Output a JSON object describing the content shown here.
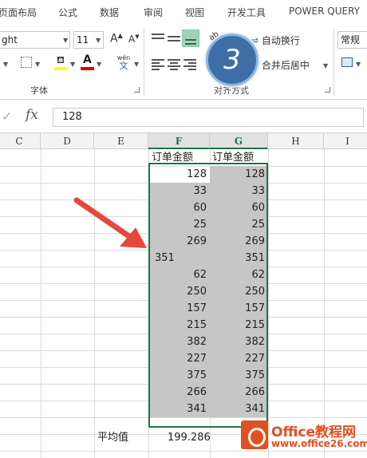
{
  "menu": {
    "tabs": [
      "页面布局",
      "公式",
      "数据",
      "审阅",
      "视图",
      "开发工具",
      "POWER QUERY"
    ]
  },
  "ribbon": {
    "font_name": "ght",
    "font_size": "11",
    "font_grow": "A",
    "font_shrink": "A",
    "font_color_letter": "A",
    "phonetic_top": "wén",
    "phonetic_bottom": "文",
    "font_group_label": "字体",
    "wrap_text": "自动换行",
    "merge_center": "合并后居中",
    "align_group_label": "对齐方式",
    "number_format": "常规",
    "orientation_label": "ab"
  },
  "formula_bar": {
    "fx_label": "fx",
    "value": "128"
  },
  "badge": {
    "label": "3"
  },
  "columns": [
    "C",
    "D",
    "E",
    "F",
    "G",
    "H",
    "I"
  ],
  "table": {
    "header_f": "订单金额",
    "header_g": "订单金额",
    "f_values": [
      "128",
      "33",
      "60",
      "25",
      "269",
      "351",
      "62",
      "250",
      "157",
      "215",
      "382",
      "227",
      "375",
      "266",
      "341"
    ],
    "g_values": [
      "128",
      "33",
      "60",
      "25",
      "269",
      "351",
      "62",
      "250",
      "157",
      "215",
      "382",
      "227",
      "375",
      "266",
      "341"
    ],
    "avg_label": "平均值",
    "avg_value": "199.286"
  },
  "watermark": {
    "title": "Office教程网",
    "url": "www.office26.com"
  },
  "colors": {
    "accent_green": "#217346",
    "arrow_red": "#e5483c",
    "badge_blue": "#3d6fa6",
    "watermark_orange": "#e3501f"
  }
}
